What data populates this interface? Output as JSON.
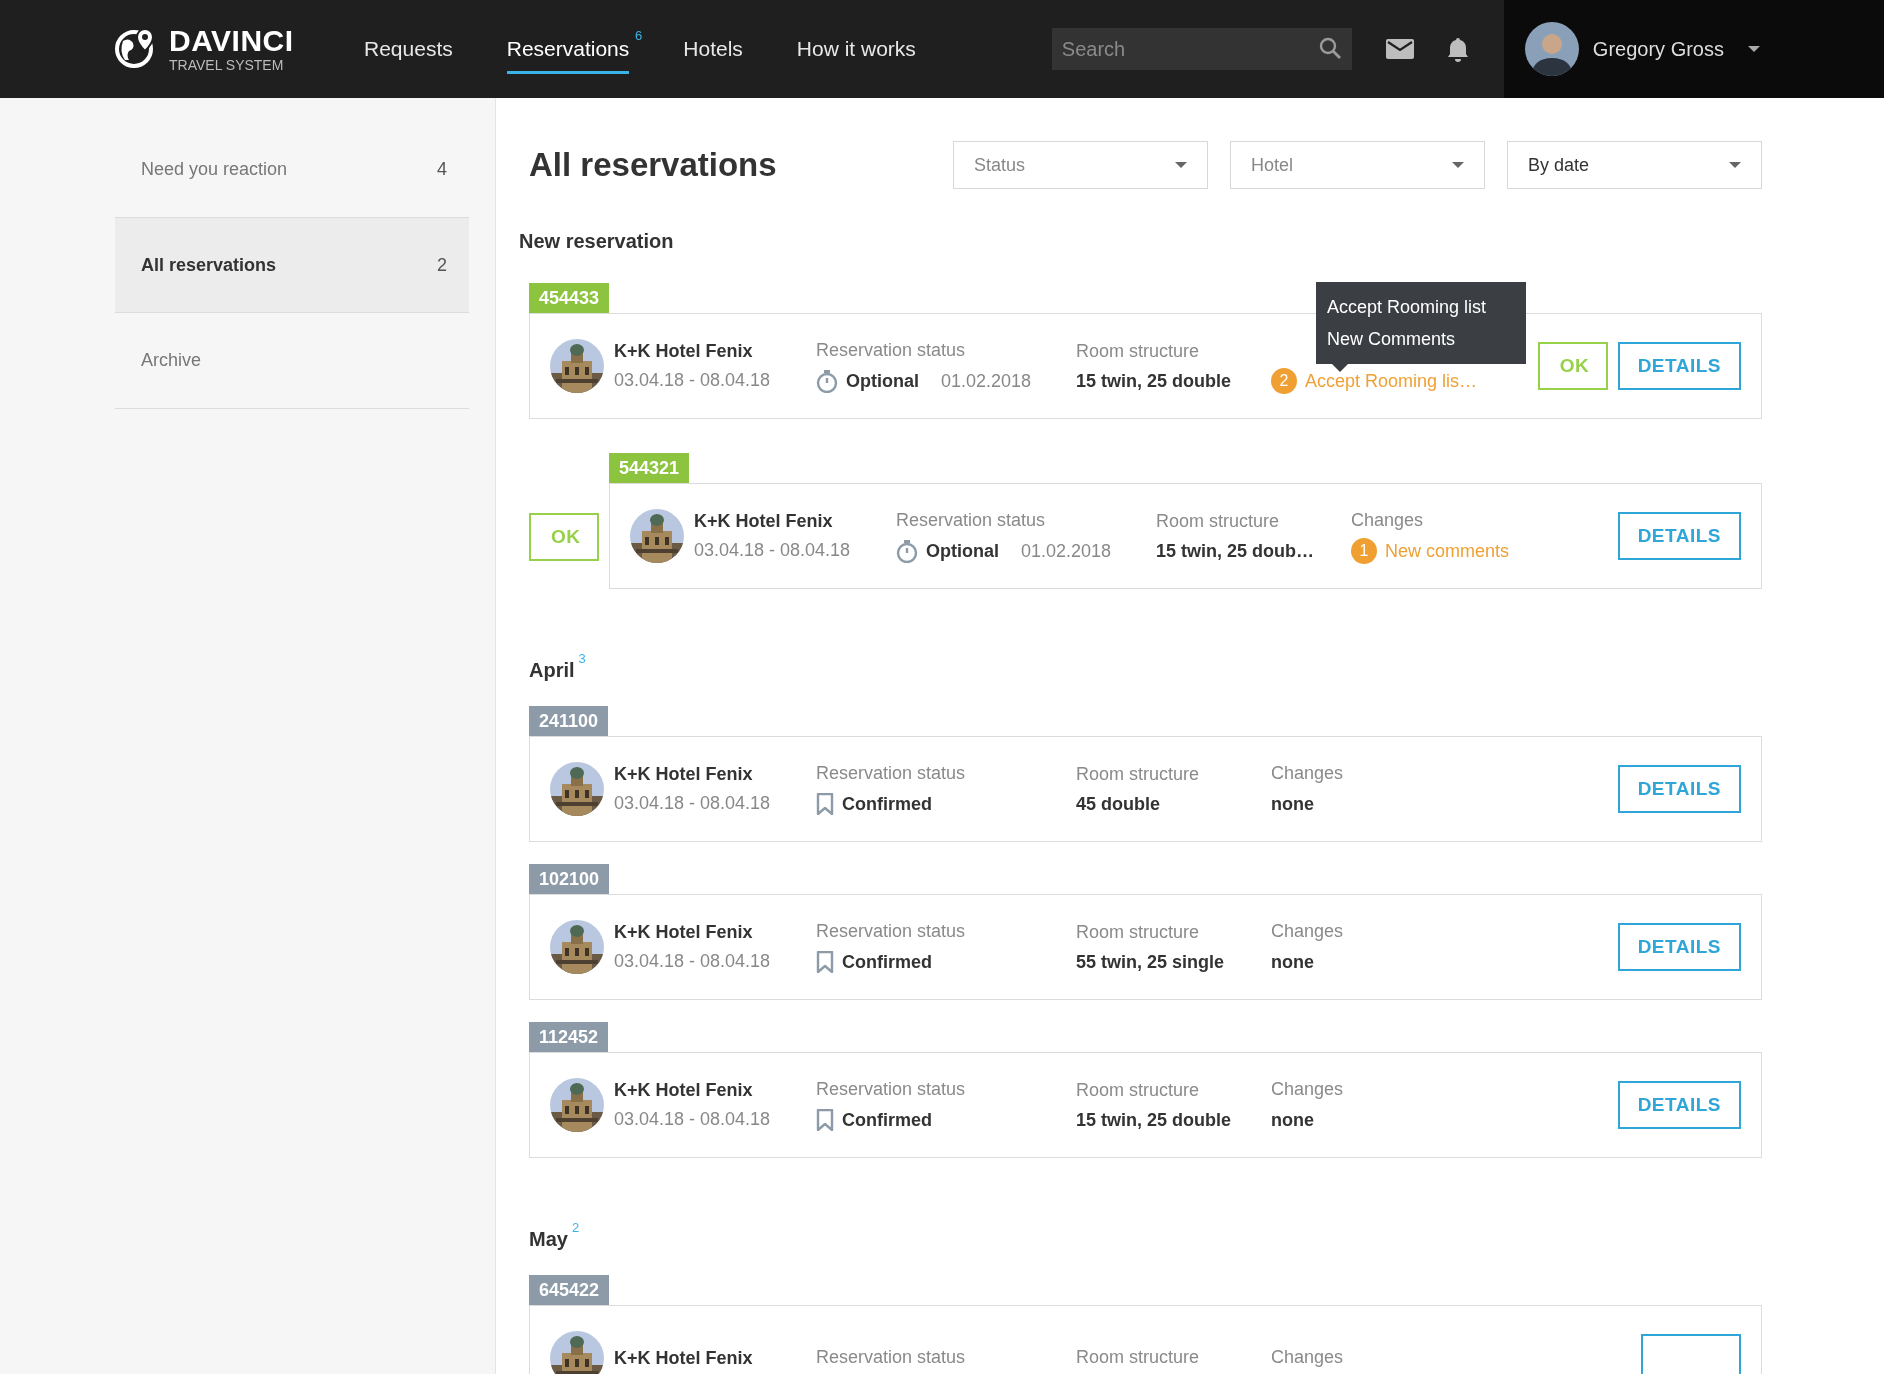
{
  "header": {
    "brand": "DAVINCI",
    "brand_sub": "TRAVEL SYSTEM",
    "nav": [
      {
        "label": "Requests",
        "selected": false
      },
      {
        "label": "Reservations",
        "selected": true,
        "badge": "6"
      },
      {
        "label": "Hotels",
        "selected": false
      },
      {
        "label": "How it works",
        "selected": false
      }
    ],
    "search": {
      "placeholder": "Search"
    },
    "user": {
      "name": "Gregory Gross"
    }
  },
  "sidebar": {
    "items": [
      {
        "label": "Need you reaction",
        "count": "4",
        "selected": false
      },
      {
        "label": "All reservations",
        "count": "2",
        "selected": true
      },
      {
        "label": "Archive",
        "selected": false
      }
    ]
  },
  "page_title": "All reservations",
  "filters": [
    {
      "label": "Status",
      "kind": "placeholder"
    },
    {
      "label": "Hotel",
      "kind": "placeholder"
    },
    {
      "label": "By date",
      "kind": "value"
    }
  ],
  "sections": [
    {
      "kind": "new",
      "title": "New reservation",
      "reservations": [
        {
          "id": "454433",
          "hotel": "K+K Hotel Fenix",
          "dates": "03.04.18 - 08.04.18",
          "status_label": "Reservation status",
          "status": {
            "kind": "optional",
            "text": "Optional",
            "date": "01.02.2018"
          },
          "room_label": "Room structure",
          "rooms": "15 twin, 25 double",
          "changes": {
            "kind": "pending",
            "count": "2",
            "text": "Accept Rooming lis…"
          },
          "tooltip": [
            "Accept Rooming list",
            "New Comments"
          ],
          "ok": {
            "label": "OK",
            "kind": "inline"
          },
          "details": "DETAILS"
        },
        {
          "id": "544321",
          "hotel": "K+K Hotel Fenix",
          "dates": "03.04.18 - 08.04.18",
          "status_label": "Reservation status",
          "status": {
            "kind": "optional",
            "text": "Optional",
            "date": "01.02.2018"
          },
          "room_label": "Room structure",
          "rooms": "15 twin, 25 doub…",
          "changes_label": "Changes",
          "changes": {
            "kind": "pending",
            "count": "1",
            "text": "New comments"
          },
          "ok": {
            "label": "OK",
            "kind": "aside"
          },
          "details": "DETAILS"
        }
      ]
    },
    {
      "kind": "month",
      "title": "April",
      "count": "3",
      "reservations": [
        {
          "id": "241100",
          "hotel": "K+K Hotel Fenix",
          "dates": "03.04.18 - 08.04.18",
          "status_label": "Reservation status",
          "status": {
            "kind": "confirmed",
            "text": "Confirmed"
          },
          "room_label": "Room structure",
          "rooms": "45 double",
          "changes_label": "Changes",
          "changes": {
            "kind": "none",
            "text": "none"
          },
          "details": "DETAILS"
        },
        {
          "id": "102100",
          "hotel": "K+K Hotel Fenix",
          "dates": "03.04.18 - 08.04.18",
          "status_label": "Reservation status",
          "status": {
            "kind": "confirmed",
            "text": "Confirmed"
          },
          "room_label": "Room structure",
          "rooms": "55 twin, 25 single",
          "changes_label": "Changes",
          "changes": {
            "kind": "none",
            "text": "none"
          },
          "details": "DETAILS"
        },
        {
          "id": "112452",
          "hotel": "K+K Hotel Fenix",
          "dates": "03.04.18 - 08.04.18",
          "status_label": "Reservation status",
          "status": {
            "kind": "confirmed",
            "text": "Confirmed"
          },
          "room_label": "Room structure",
          "rooms": "15 twin, 25 double",
          "changes_label": "Changes",
          "changes": {
            "kind": "none",
            "text": "none"
          },
          "details": "DETAILS"
        }
      ]
    },
    {
      "kind": "month",
      "title": "May",
      "count": "2",
      "reservations": [
        {
          "id": "645422",
          "hotel": "K+K Hotel Fenix",
          "status_label": "Reservation status",
          "room_label": "Room structure",
          "changes_label": "Changes"
        }
      ]
    }
  ]
}
